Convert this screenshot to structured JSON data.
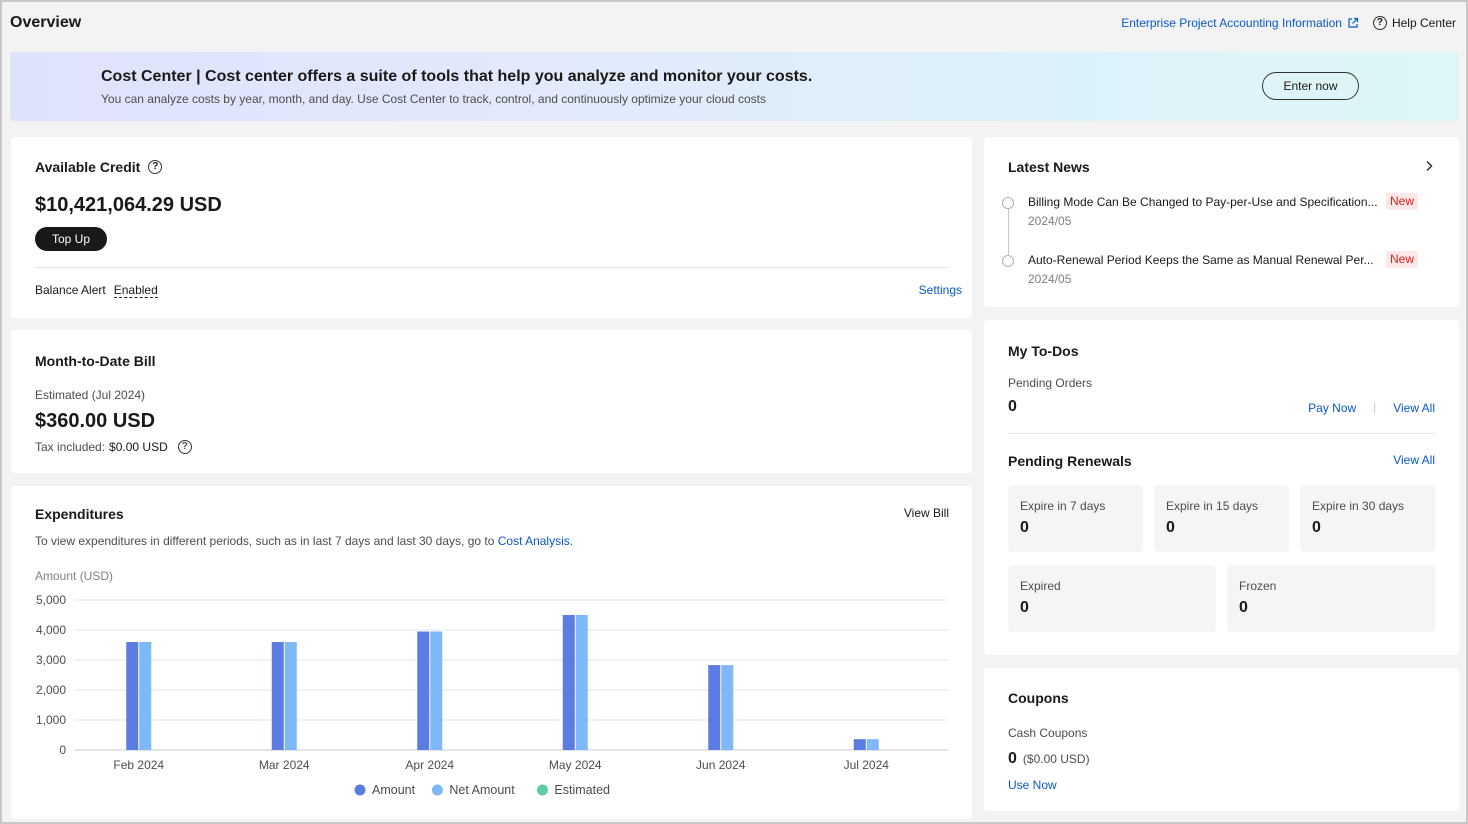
{
  "header": {
    "title": "Overview",
    "enterprise_link": "Enterprise Project Accounting Information",
    "help_center": "Help Center"
  },
  "banner": {
    "title": "Cost Center | Cost center offers a suite of tools that help you analyze and monitor your costs.",
    "subtitle": "You can analyze costs by year, month, and day. Use Cost Center to track, control, and continuously optimize your cloud costs",
    "button": "Enter now"
  },
  "credit": {
    "title": "Available Credit",
    "amount": "$10,421,064.29 USD",
    "topup": "Top Up",
    "alert_label": "Balance Alert",
    "alert_status": "Enabled",
    "settings": "Settings"
  },
  "mtd": {
    "title": "Month-to-Date Bill",
    "estimated": "Estimated (Jul 2024)",
    "amount": "$360.00 USD",
    "tax_label": "Tax included:",
    "tax_value": "$0.00 USD"
  },
  "expenditures": {
    "title": "Expenditures",
    "view_bill": "View Bill",
    "desc_prefix": "To view expenditures in different periods, such as in last 7 days and last 30 days, go to",
    "desc_link": "Cost Analysis",
    "desc_suffix": "."
  },
  "chart_data": {
    "type": "bar",
    "ylabel": "Amount (USD)",
    "ylim": [
      0,
      5000
    ],
    "yticks": [
      "0",
      "1,000",
      "2,000",
      "3,000",
      "4,000",
      "5,000"
    ],
    "categories": [
      "Feb 2024",
      "Mar 2024",
      "Apr 2024",
      "May 2024",
      "Jun 2024",
      "Jul 2024"
    ],
    "series": [
      {
        "name": "Amount",
        "color": "#5b7ce0",
        "values": [
          3600,
          3600,
          3950,
          4500,
          2830,
          360
        ]
      },
      {
        "name": "Net Amount",
        "color": "#7fb8f7",
        "values": [
          3600,
          3600,
          3950,
          4500,
          2830,
          360
        ]
      },
      {
        "name": "Estimated",
        "color": "#5fcba5",
        "values": [
          0,
          0,
          0,
          0,
          0,
          0
        ]
      }
    ],
    "grid": true,
    "legend": "bottom"
  },
  "news": {
    "title": "Latest News",
    "items": [
      {
        "title": "Billing Mode Can Be Changed to Pay-per-Use and Specification...",
        "date": "2024/05",
        "badge": "New"
      },
      {
        "title": "Auto-Renewal Period Keeps the Same as Manual Renewal Per...",
        "date": "2024/05",
        "badge": "New"
      }
    ]
  },
  "todos": {
    "title": "My To-Dos",
    "pending_orders_label": "Pending Orders",
    "pending_orders_value": "0",
    "pay_now": "Pay Now",
    "view_all": "View All",
    "renewals_title": "Pending Renewals",
    "renewals_view_all": "View All",
    "renewals": [
      {
        "label": "Expire in 7 days",
        "value": "0"
      },
      {
        "label": "Expire in 15 days",
        "value": "0"
      },
      {
        "label": "Expire in 30 days",
        "value": "0"
      },
      {
        "label": "Expired",
        "value": "0"
      },
      {
        "label": "Frozen",
        "value": "0"
      }
    ]
  },
  "coupons": {
    "title": "Coupons",
    "cash_label": "Cash Coupons",
    "cash_value": "0",
    "cash_usd": "($0.00 USD)",
    "use_now": "Use Now"
  }
}
